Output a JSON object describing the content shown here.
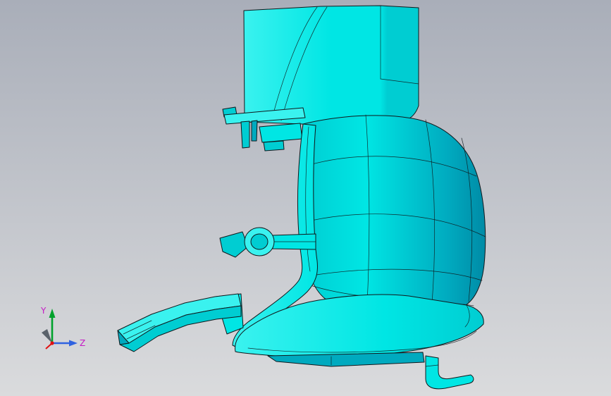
{
  "triad": {
    "y_label": "Y",
    "z_label": "Z"
  },
  "colors": {
    "bg_top": "#a9aeb9",
    "bg_bottom": "#dadbdd",
    "model_bright": "#3af2ef",
    "model_light": "#00e6e4",
    "model_mid": "#00cdd2",
    "model_dark": "#00aabf",
    "model_deep": "#008ba6",
    "edge": "#10181c",
    "axis_y": "#00a12c",
    "axis_z": "#2f62e0",
    "axis_x": "#e01010",
    "axis_origin": "#5a626b",
    "axis_label": "#c519c5"
  }
}
